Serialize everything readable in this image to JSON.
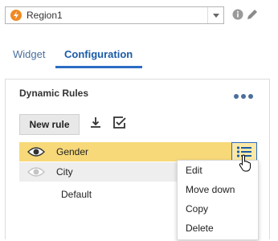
{
  "region": {
    "label": "Region1",
    "icon": "lightning-icon",
    "accent": "#f08a24"
  },
  "header_actions": {
    "info_icon": "info-icon",
    "edit_icon": "pencil-icon"
  },
  "tabs": [
    {
      "label": "Widget",
      "active": false
    },
    {
      "label": "Configuration",
      "active": true
    }
  ],
  "panel": {
    "title": "Dynamic Rules",
    "new_rule_label": "New rule",
    "rules": [
      {
        "label": "Gender",
        "visible": true,
        "selected": true
      },
      {
        "label": "City",
        "visible": false,
        "selected": false
      },
      {
        "label": "Default"
      }
    ]
  },
  "context_menu": {
    "items": [
      "Edit",
      "Move down",
      "Copy",
      "Delete"
    ]
  },
  "colors": {
    "selected_row": "#f7d97a",
    "accent_blue": "#2b6cc4"
  }
}
